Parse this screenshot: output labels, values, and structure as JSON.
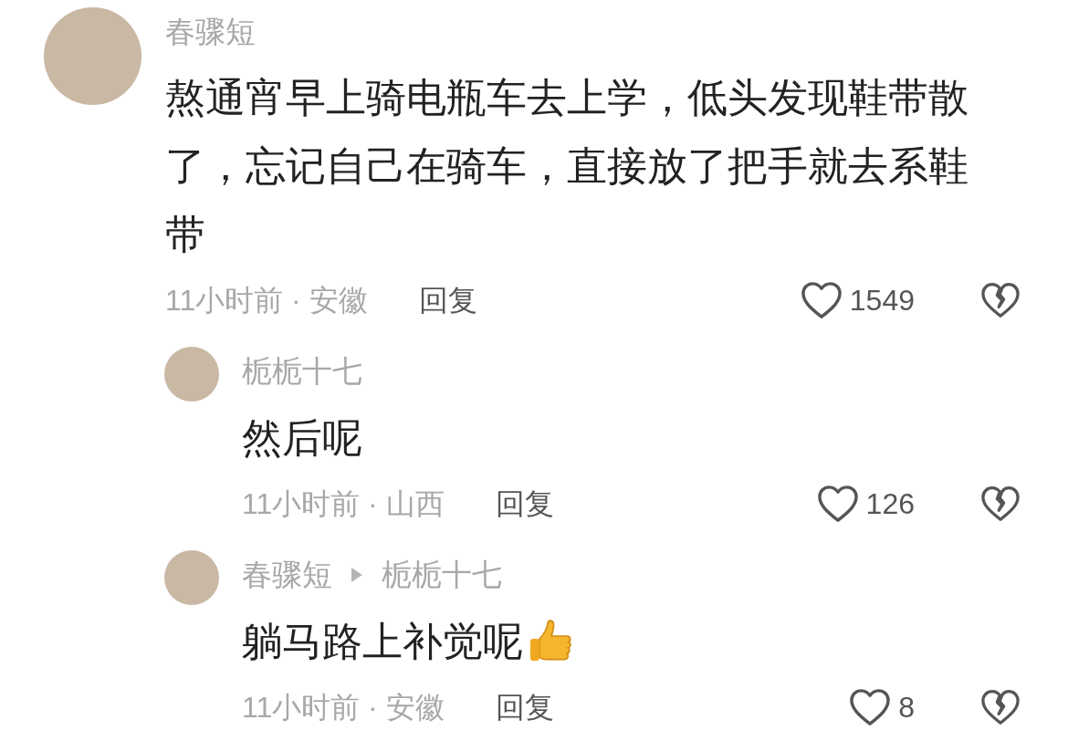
{
  "comments": [
    {
      "author": "春骤短",
      "text": "熬通宵早上骑电瓶车去上学，低头发现鞋带散了，忘记自己在骑车，直接放了把手就去系鞋带",
      "time": "11小时前 · 安徽",
      "reply_label": "回复",
      "likes": "1549",
      "replies": [
        {
          "author": "栀栀十七",
          "text": "然后呢",
          "thumbs_up_sticker": false,
          "time": "11小时前 · 山西",
          "reply_label": "回复",
          "likes": "126"
        },
        {
          "author": "春骤短",
          "reply_to": "栀栀十七",
          "text": "躺马路上补觉呢",
          "thumbs_up_sticker": true,
          "time": "11小时前 · 安徽",
          "reply_label": "回复",
          "likes": "8"
        }
      ]
    }
  ]
}
